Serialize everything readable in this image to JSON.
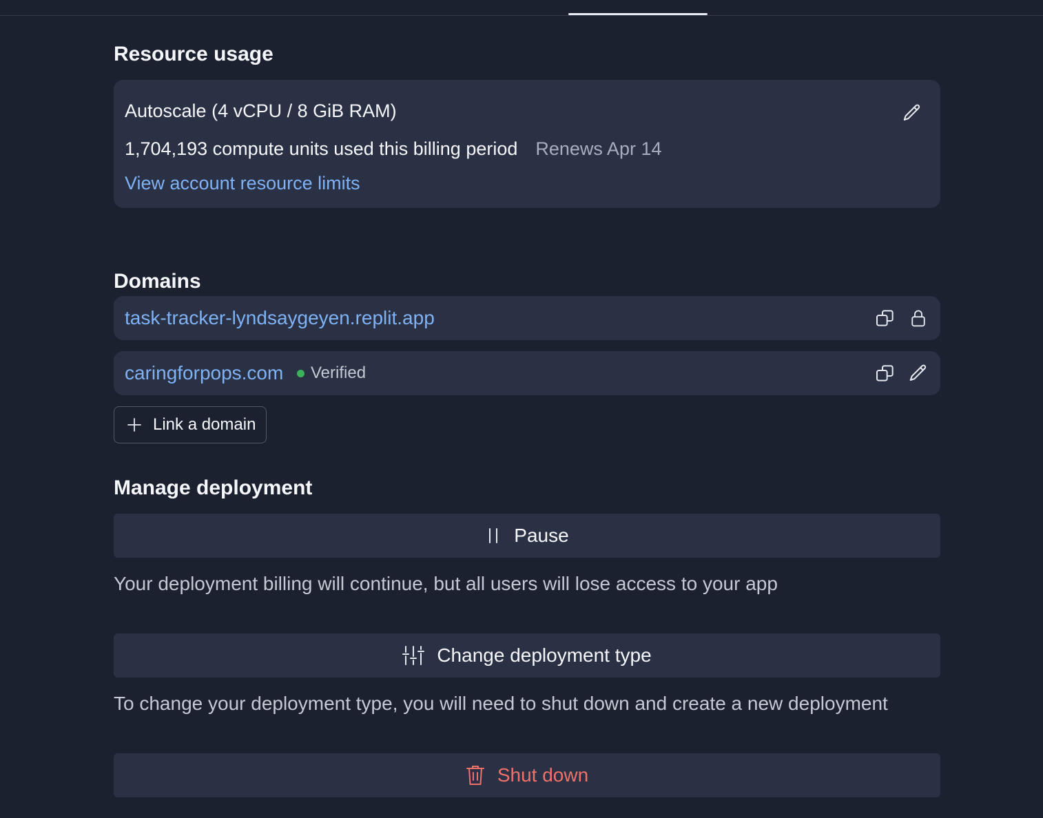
{
  "resource_usage": {
    "heading": "Resource usage",
    "plan": "Autoscale (4 vCPU / 8 GiB RAM)",
    "compute_units": "1,704,193 compute units used this billing period",
    "renews": "Renews Apr 14",
    "limits_link": "View account resource limits",
    "edit_icon": "pencil-icon"
  },
  "domains": {
    "heading": "Domains",
    "items": [
      {
        "url": "task-tracker-lyndsaygeyen.replit.app",
        "status": "",
        "icons": [
          "copy-icon",
          "lock-icon"
        ]
      },
      {
        "url": "caringforpops.com",
        "status": "Verified",
        "status_color": "#3cb25a",
        "icons": [
          "copy-icon",
          "pencil-icon"
        ]
      }
    ],
    "add_button": "Link a domain"
  },
  "manage": {
    "heading": "Manage deployment",
    "pause_label": "Pause",
    "pause_desc": "Your deployment billing will continue, but all users will lose access to your app",
    "change_label": "Change deployment type",
    "change_desc": "To change your deployment type, you will need to shut down and create a new deployment",
    "shutdown_label": "Shut down",
    "shutdown_color": "#f0706a"
  }
}
